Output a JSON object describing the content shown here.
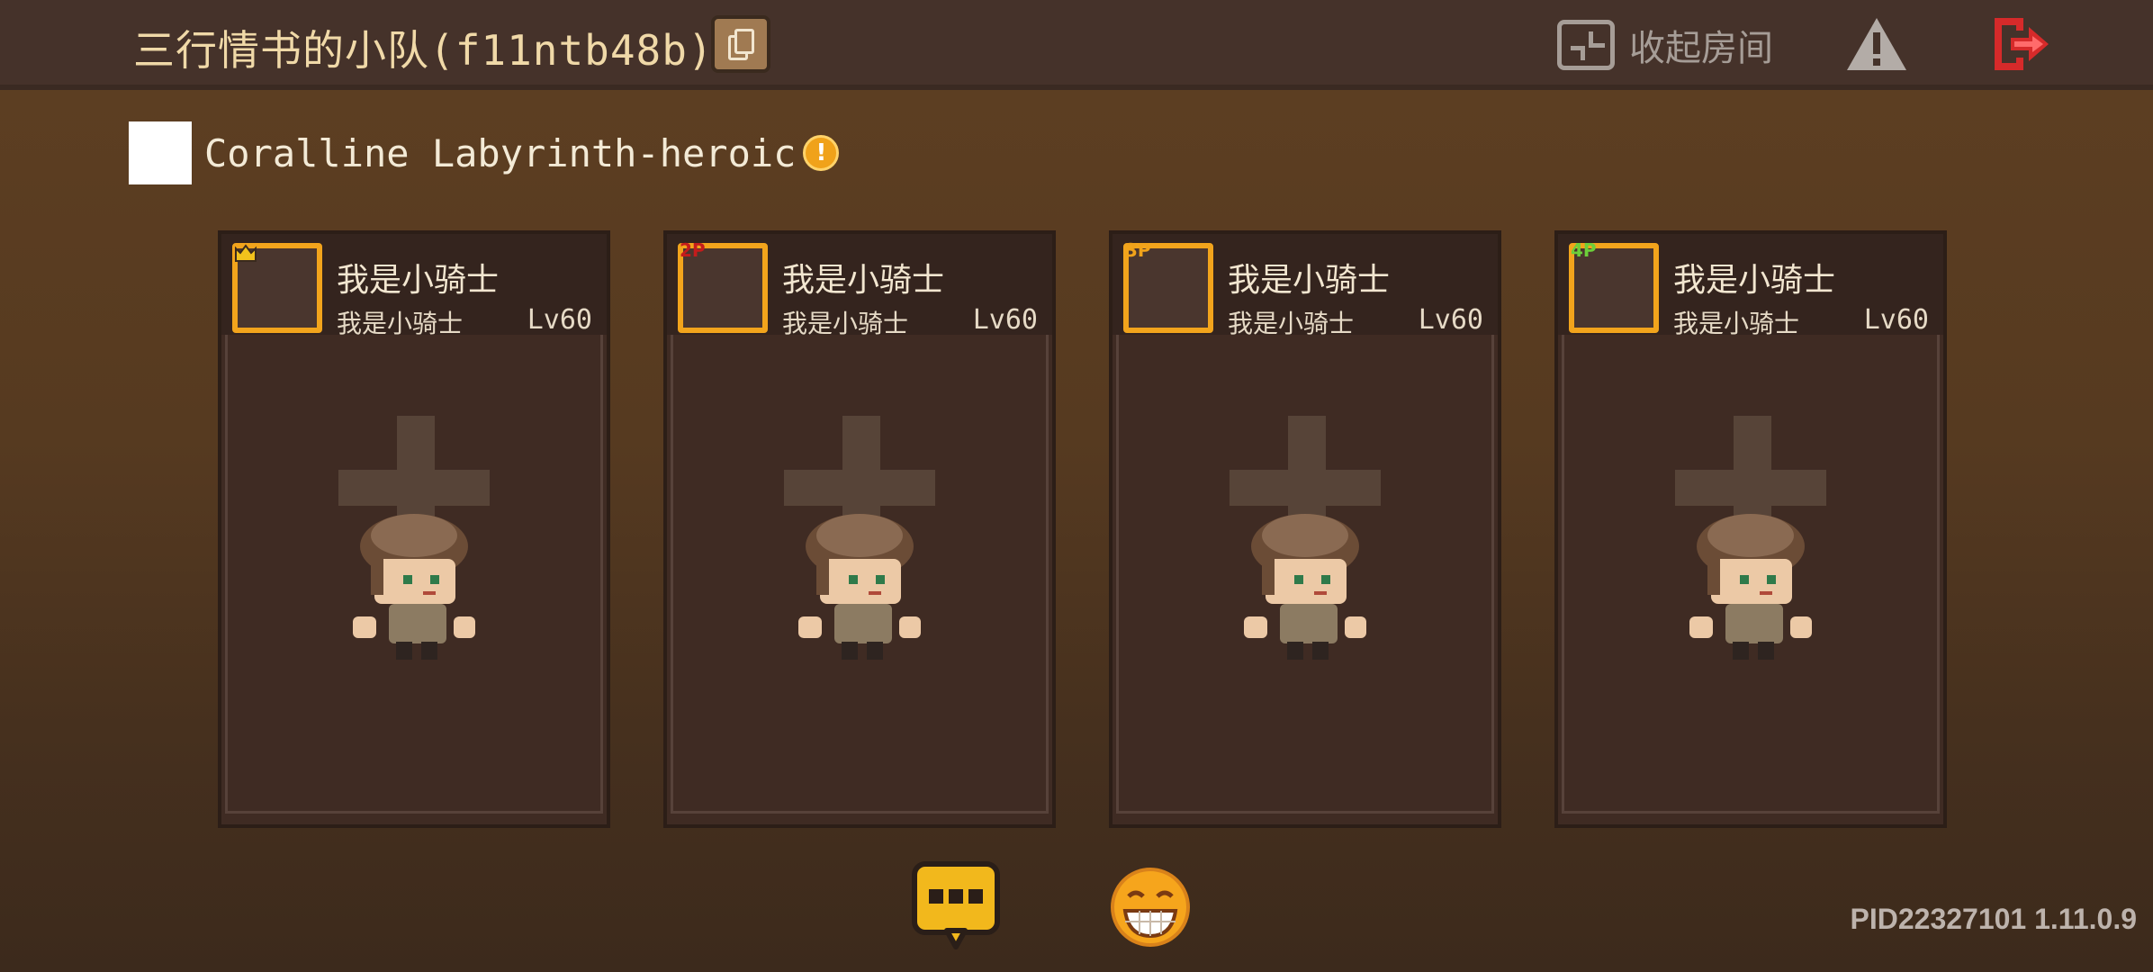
{
  "header": {
    "team_title": "三行情书的小队(f11ntb48b)",
    "copy_icon": "copy-icon",
    "collapse_label": "收起房间",
    "collapse_icon": "collapse-icon",
    "warn_icon": "warning-icon",
    "exit_icon": "exit-icon"
  },
  "dungeon": {
    "name": "Coralline Labyrinth-heroic",
    "info_icon": "info-icon",
    "info_symbol": "!"
  },
  "players": [
    {
      "slot": "1",
      "badge": "crown-icon",
      "badge_text": "",
      "badge_color": "#f2c21c",
      "name": "我是小骑士",
      "subtitle": "我是小骑士",
      "level": "Lv60"
    },
    {
      "slot": "2",
      "badge": "2p-icon",
      "badge_text": "2P",
      "badge_color": "#c41c1c",
      "name": "我是小骑士",
      "subtitle": "我是小骑士",
      "level": "Lv60"
    },
    {
      "slot": "3",
      "badge": "3p-icon",
      "badge_text": "3P",
      "badge_color": "#f0a21a",
      "name": "我是小骑士",
      "subtitle": "我是小骑士",
      "level": "Lv60"
    },
    {
      "slot": "4",
      "badge": "4p-icon",
      "badge_text": "4P",
      "badge_color": "#6ccf3a",
      "name": "我是小骑士",
      "subtitle": "我是小骑士",
      "level": "Lv60"
    }
  ],
  "bottom": {
    "chat_icon": "chat-icon",
    "emoji_icon": "emoji-icon",
    "pid_version": "PID22327101 1.11.0.9"
  },
  "colors": {
    "accent_frame": "#f2a41c",
    "title_text": "#f0d9a8",
    "exit_red": "#d62a2a"
  }
}
